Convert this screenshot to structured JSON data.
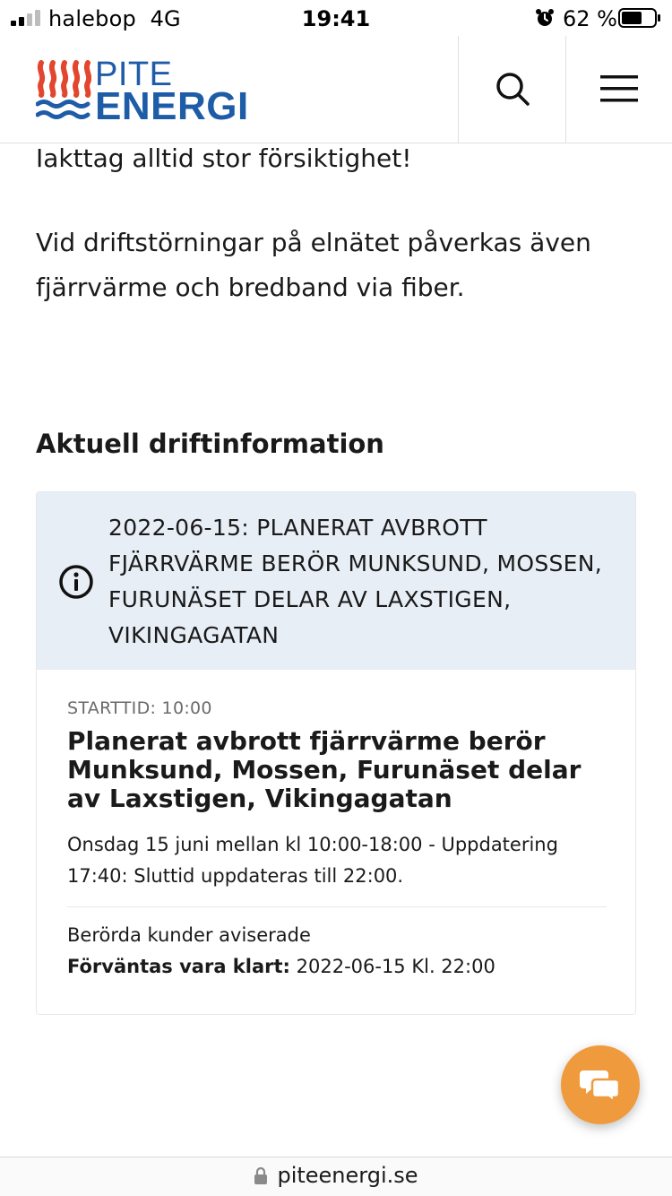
{
  "status_bar": {
    "carrier": "halebop",
    "network": "4G",
    "time": "19:41",
    "battery_percent": "62 %"
  },
  "header": {
    "logo_line1": "PITE",
    "logo_line2": "ENERGI",
    "brand_blue": "#1f5ca8",
    "brand_red": "#e2462e"
  },
  "content": {
    "paragraph_1": "Iakttag alltid stor försiktighet!",
    "paragraph_2": "Vid driftstörningar på elnätet påverkas även fjärrvärme och bredband via fiber.",
    "section_title": "Aktuell driftinformation"
  },
  "notice": {
    "heading": "2022-06-15: PLANERAT AVBROTT FJÄRRVÄRME BERÖR MUNKSUND, MOSSEN, FURUNÄSET DELAR AV LAXSTIGEN, VIKINGAGATAN",
    "start_time": "STARTTID: 10:00",
    "title": "Planerat avbrott fjärrvärme berör Munksund, Mossen, Furunäset delar av Laxstigen, Vikingagatan",
    "description": "Onsdag 15 juni mellan kl 10:00-18:00 - Uppdatering 17:40: Sluttid uppdateras till 22:00.",
    "affected": "Berörda kunder aviserade",
    "expected_label": "Förväntas vara klart:",
    "expected_value": "2022-06-15 Kl. 22:00",
    "head_bg": "#e8eef6"
  },
  "chat": {
    "icon": "chat-bubbles-icon",
    "color": "#ef9a3c"
  },
  "url_bar": {
    "url": "piteenergi.se"
  }
}
